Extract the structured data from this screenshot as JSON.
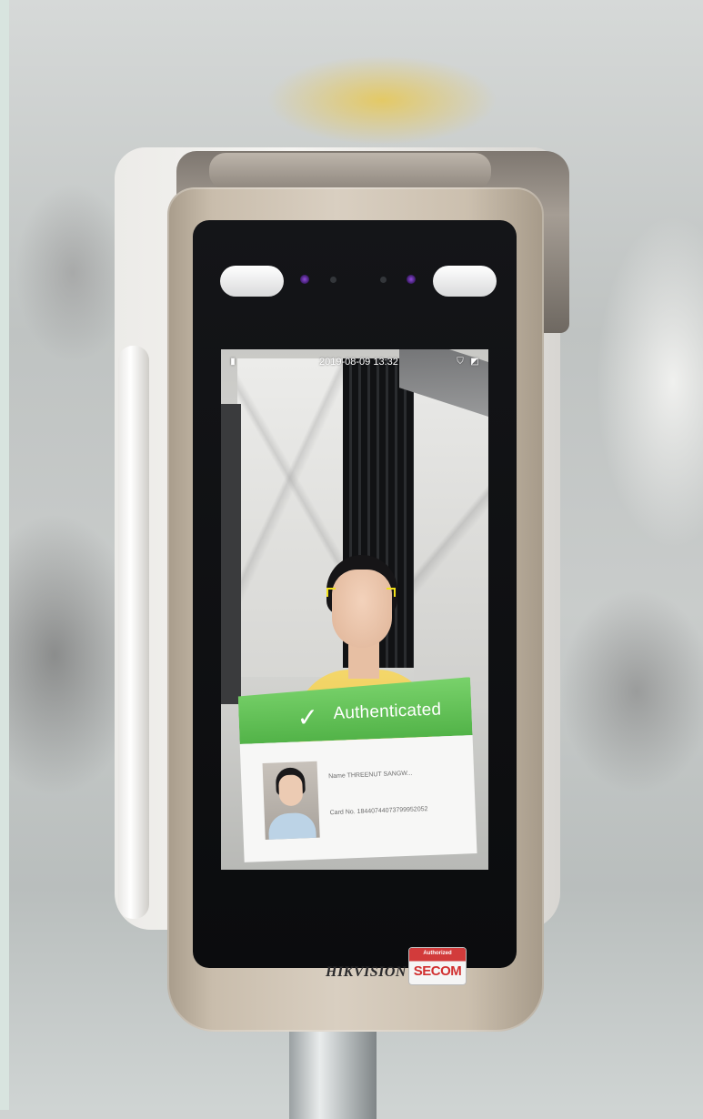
{
  "screen": {
    "status_time": "2019-08-09  13:32",
    "icons": [
      "door-icon",
      "shield-icon",
      "network-icon"
    ]
  },
  "auth": {
    "title": "Authenticated",
    "check_icon": "check-icon",
    "name_line": "Name THREENUT SANGW...",
    "card_line": "Card No. 18440744073799952052"
  },
  "device": {
    "brand": "HIKVISION",
    "badge_top": "Authorized",
    "badge_main": "SECOM"
  },
  "colors": {
    "auth_green": "#52b348",
    "face_frame": "#f2e11a",
    "badge_red": "#d12f2f"
  }
}
